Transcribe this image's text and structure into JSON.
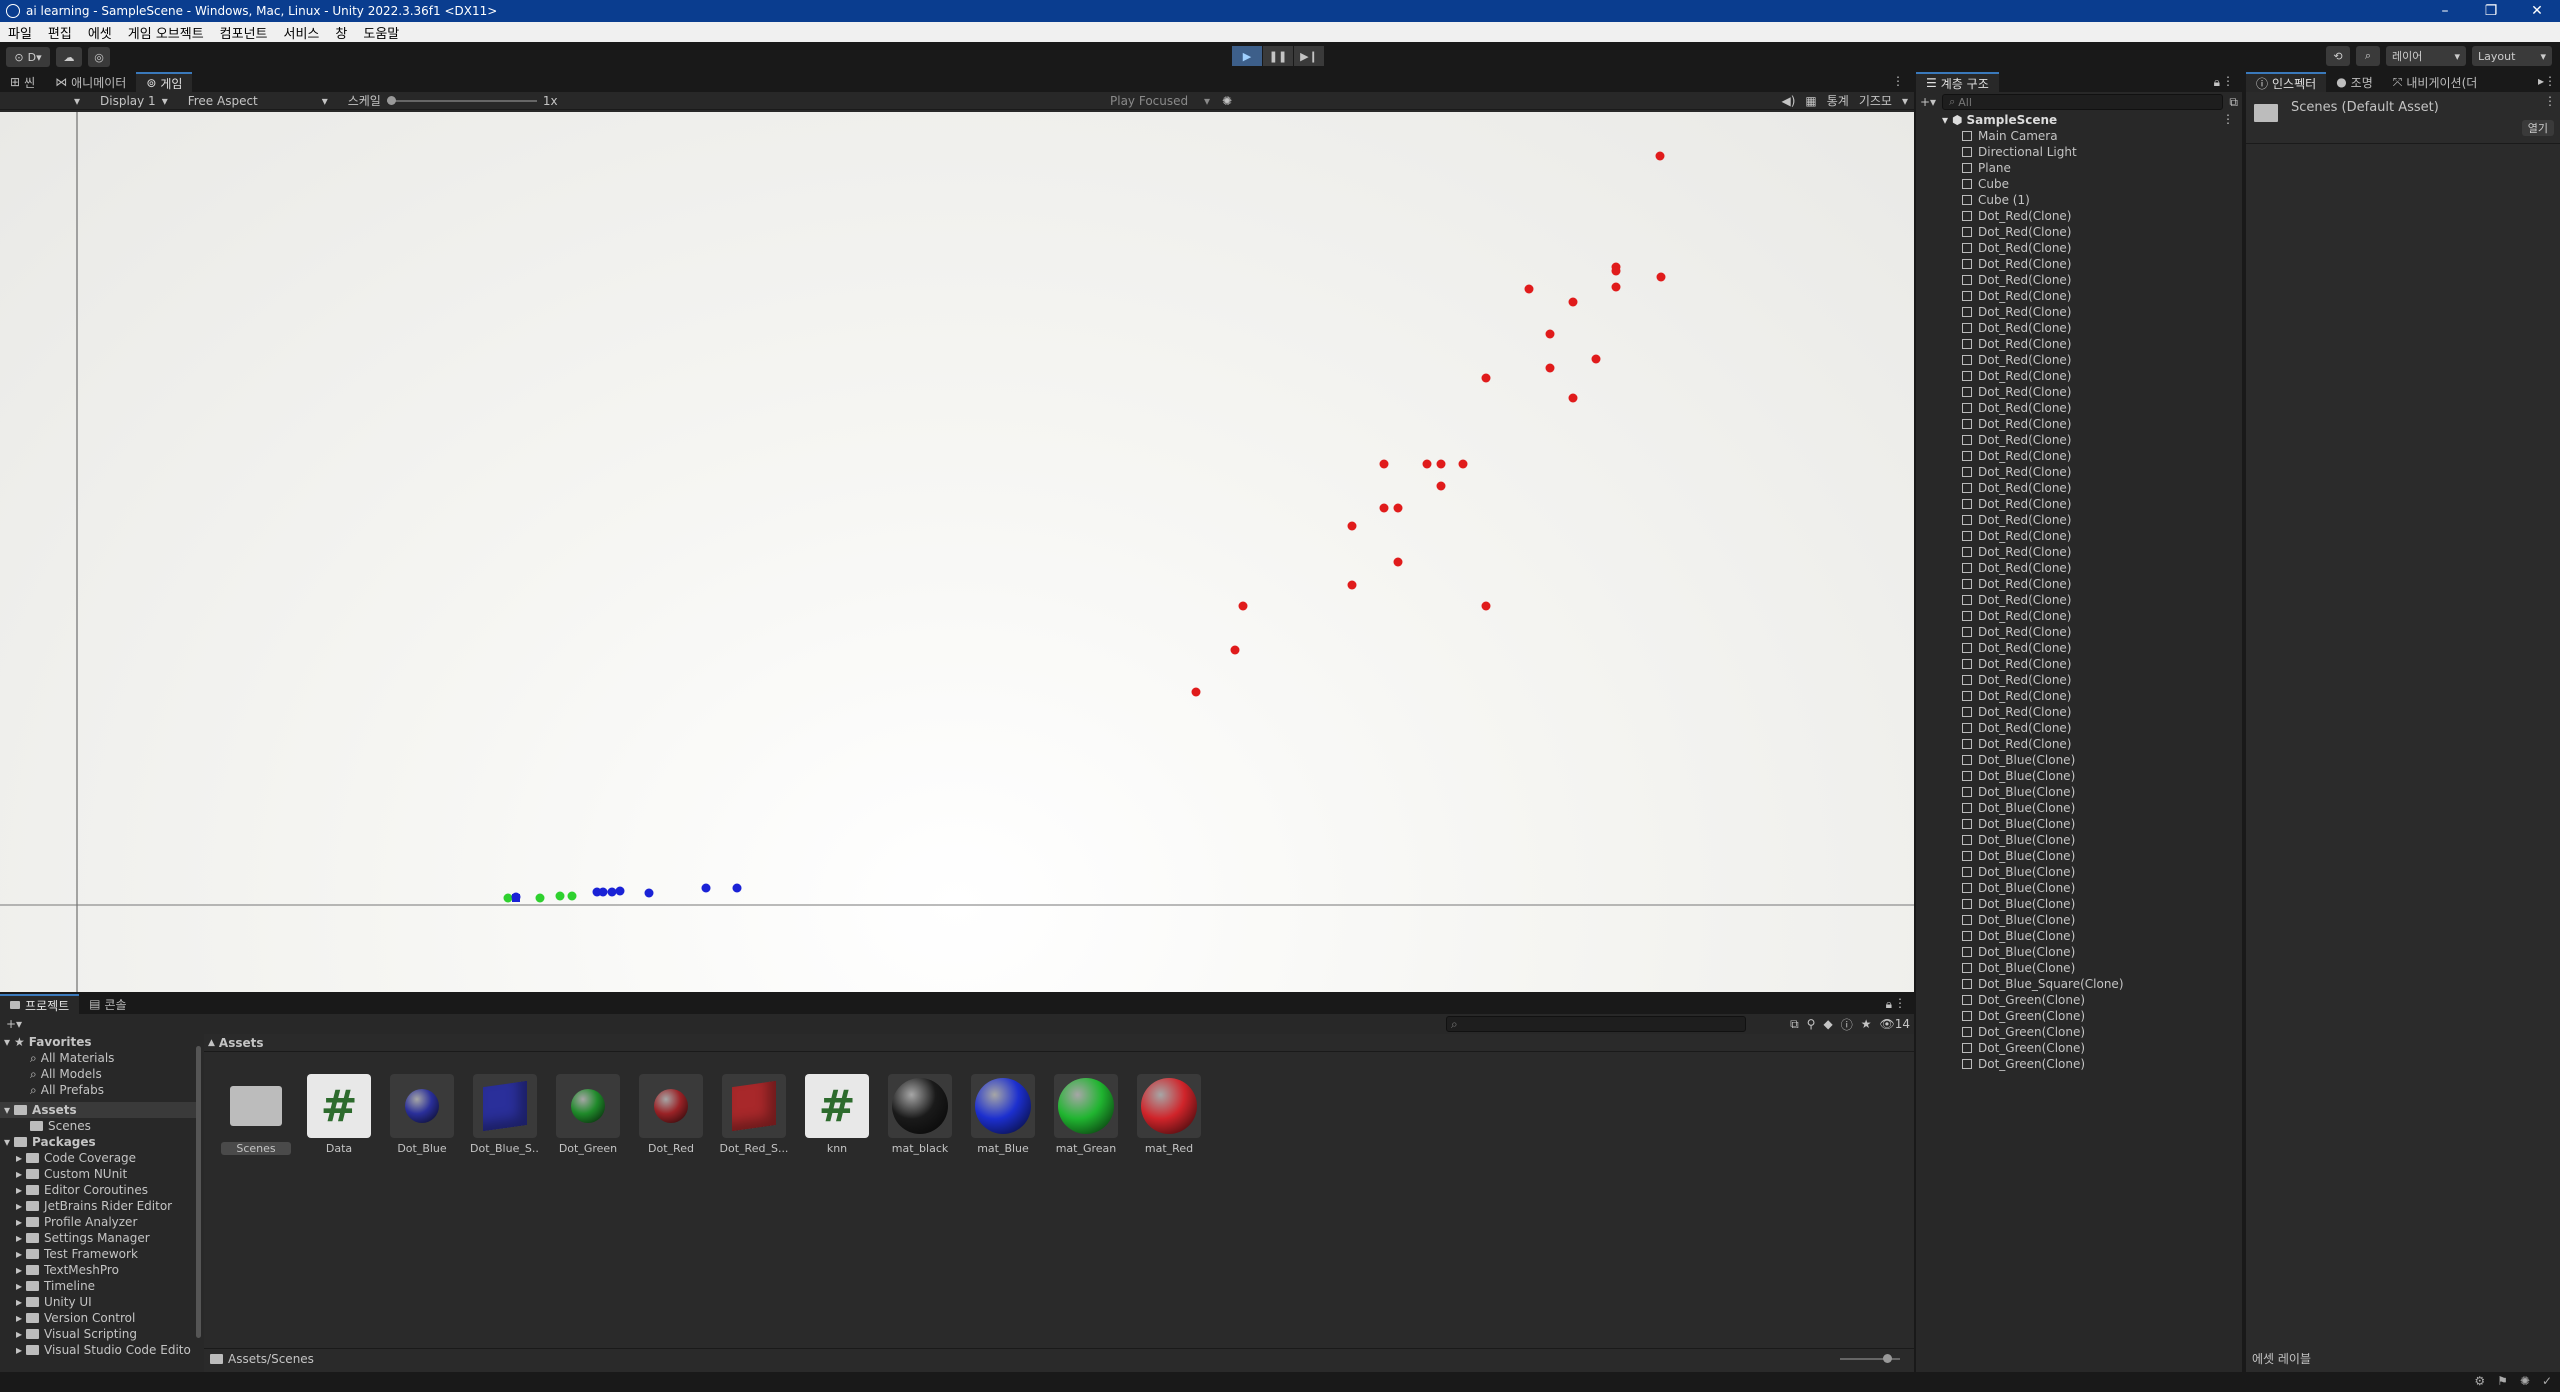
{
  "window": {
    "title": "ai learning - SampleScene - Windows, Mac, Linux - Unity 2022.3.36f1 <DX11>",
    "controls": [
      "–",
      "❐",
      "✕"
    ]
  },
  "menu": [
    "파일",
    "편집",
    "에셋",
    "게임 오브젝트",
    "컴포넌트",
    "서비스",
    "창",
    "도움말"
  ],
  "toolbar": {
    "account": "D",
    "layer_label": "레이어",
    "layout_label": "Layout"
  },
  "scene_tabs": [
    "씬",
    "애니메이터",
    "게임"
  ],
  "gamebar": {
    "display": "Display 1",
    "aspect": "Free Aspect",
    "scale_label": "스케일",
    "scale_value": "1x",
    "play_mode": "Play Focused",
    "stats": "통계",
    "gizmos": "기즈모"
  },
  "hierarchy": {
    "tab": "계층 구조",
    "search_placeholder": "All",
    "scene": "SampleScene",
    "items": [
      "Main Camera",
      "Directional Light",
      "Plane",
      "Cube",
      "Cube (1)",
      "Dot_Red(Clone)",
      "Dot_Red(Clone)",
      "Dot_Red(Clone)",
      "Dot_Red(Clone)",
      "Dot_Red(Clone)",
      "Dot_Red(Clone)",
      "Dot_Red(Clone)",
      "Dot_Red(Clone)",
      "Dot_Red(Clone)",
      "Dot_Red(Clone)",
      "Dot_Red(Clone)",
      "Dot_Red(Clone)",
      "Dot_Red(Clone)",
      "Dot_Red(Clone)",
      "Dot_Red(Clone)",
      "Dot_Red(Clone)",
      "Dot_Red(Clone)",
      "Dot_Red(Clone)",
      "Dot_Red(Clone)",
      "Dot_Red(Clone)",
      "Dot_Red(Clone)",
      "Dot_Red(Clone)",
      "Dot_Red(Clone)",
      "Dot_Red(Clone)",
      "Dot_Red(Clone)",
      "Dot_Red(Clone)",
      "Dot_Red(Clone)",
      "Dot_Red(Clone)",
      "Dot_Red(Clone)",
      "Dot_Red(Clone)",
      "Dot_Red(Clone)",
      "Dot_Red(Clone)",
      "Dot_Red(Clone)",
      "Dot_Red(Clone)",
      "Dot_Blue(Clone)",
      "Dot_Blue(Clone)",
      "Dot_Blue(Clone)",
      "Dot_Blue(Clone)",
      "Dot_Blue(Clone)",
      "Dot_Blue(Clone)",
      "Dot_Blue(Clone)",
      "Dot_Blue(Clone)",
      "Dot_Blue(Clone)",
      "Dot_Blue(Clone)",
      "Dot_Blue(Clone)",
      "Dot_Blue(Clone)",
      "Dot_Blue(Clone)",
      "Dot_Blue(Clone)",
      "Dot_Blue_Square(Clone)",
      "Dot_Green(Clone)",
      "Dot_Green(Clone)",
      "Dot_Green(Clone)",
      "Dot_Green(Clone)",
      "Dot_Green(Clone)"
    ]
  },
  "inspector": {
    "tabs": [
      "인스펙터",
      "조명",
      "내비게이션(더"
    ],
    "asset_title": "Scenes (Default Asset)",
    "open_button": "열기",
    "footer": "에셋 레이블"
  },
  "project": {
    "tabs": [
      "프로젝트",
      "콘솔"
    ],
    "favorites_label": "Favorites",
    "favorites": [
      "All Materials",
      "All Models",
      "All Prefabs"
    ],
    "assets_label": "Assets",
    "assets_children": [
      "Scenes"
    ],
    "packages_label": "Packages",
    "packages": [
      "Code Coverage",
      "Custom NUnit",
      "Editor Coroutines",
      "JetBrains Rider Editor",
      "Profile Analyzer",
      "Settings Manager",
      "Test Framework",
      "TextMeshPro",
      "Timeline",
      "Unity UI",
      "Version Control",
      "Visual Scripting",
      "Visual Studio Code Edito"
    ],
    "breadcrumb_header": "Assets",
    "path": "Assets/Scenes",
    "visible_count": "14",
    "grid_items": [
      {
        "label": "Scenes",
        "kind": "folder"
      },
      {
        "label": "Data",
        "kind": "script"
      },
      {
        "label": "Dot_Blue",
        "kind": "prefab",
        "color": "#2a2f9a"
      },
      {
        "label": "Dot_Blue_S...",
        "kind": "cube",
        "color": "#2a2f9a"
      },
      {
        "label": "Dot_Green",
        "kind": "prefab",
        "color": "#1f8a2a"
      },
      {
        "label": "Dot_Red",
        "kind": "prefab",
        "color": "#9a2226"
      },
      {
        "label": "Dot_Red_S...",
        "kind": "cube",
        "color": "#a8282a"
      },
      {
        "label": "knn",
        "kind": "script"
      },
      {
        "label": "mat_black",
        "kind": "material",
        "color": "#1a1a1a"
      },
      {
        "label": "mat_Blue",
        "kind": "material",
        "color": "#1c2fcf"
      },
      {
        "label": "mat_Grean",
        "kind": "material",
        "color": "#20b530"
      },
      {
        "label": "mat_Red",
        "kind": "material",
        "color": "#d0242a"
      }
    ]
  },
  "colors": {
    "red_dot": "#e01b1b",
    "blue_dot": "#1a22d6",
    "green_dot": "#2ed12e",
    "accent": "#3a79bb"
  }
}
